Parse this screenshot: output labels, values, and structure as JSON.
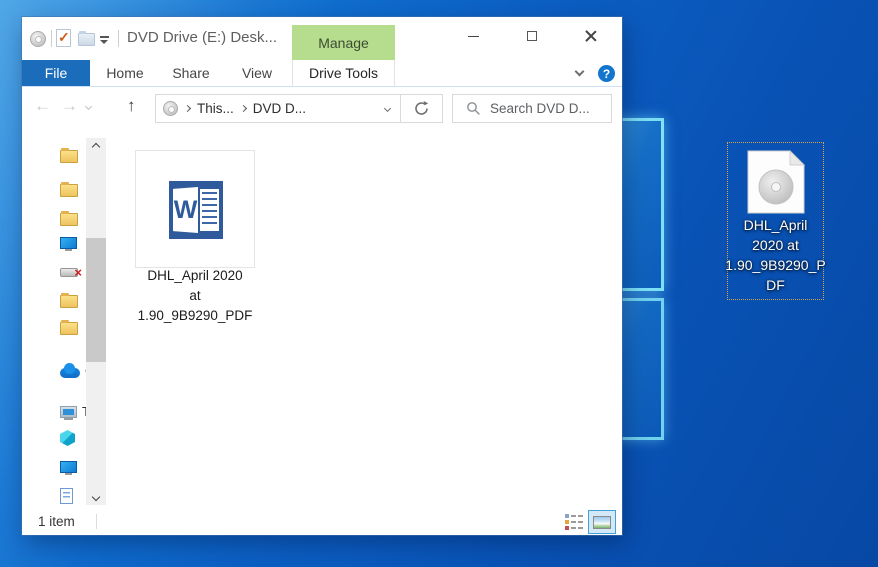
{
  "colors": {
    "accent_blue": "#1b6dbb",
    "manage_green": "#b5dd8d",
    "desktop_blue": "#0c60c4",
    "selection_dotted_border": "#d8a245",
    "word_blue": "#2f5b9d"
  },
  "glyphs": {
    "back_arrow": "←",
    "forward_arrow": "→",
    "up_arrow": "↑",
    "check": "✓",
    "drive_disconnect_x": "×",
    "help": "?"
  },
  "window": {
    "title": "DVD Drive (E:) Desk...",
    "qat_icons": [
      "disc-icon",
      "properties-check-icon",
      "new-folder-icon",
      "customize-caret-icon"
    ],
    "contextual": {
      "header": "Manage",
      "tab": "Drive Tools"
    },
    "tabs": {
      "file": "File",
      "home": "Home",
      "share": "Share",
      "view": "View"
    },
    "controls": [
      "minimize",
      "maximize",
      "close"
    ]
  },
  "navbar": {
    "breadcrumb": {
      "segments": [
        "This...",
        "DVD D..."
      ]
    },
    "search_placeholder": "Search DVD D..."
  },
  "sidebar": {
    "items": [
      {
        "icon": "folder-icon",
        "label": ""
      },
      {
        "icon": "folder-icon",
        "label": ""
      },
      {
        "icon": "folder-icon",
        "label": ""
      },
      {
        "icon": "desktop-monitor-icon",
        "label": ""
      },
      {
        "icon": "disconnected-drive-icon",
        "label": ""
      },
      {
        "icon": "folder-icon",
        "label": ""
      },
      {
        "icon": "folder-icon",
        "label": ""
      },
      {
        "icon": "onedrive-cloud-icon",
        "label": "C"
      },
      {
        "icon": "this-pc-icon",
        "label": "T"
      },
      {
        "icon": "3d-objects-cube-icon",
        "label": ""
      },
      {
        "icon": "desktop-monitor-icon",
        "label": ""
      },
      {
        "icon": "documents-icon",
        "label": ""
      }
    ]
  },
  "content": {
    "file": {
      "icon": "word-document-icon",
      "icon_letter": "W",
      "name_lines": [
        "DHL_April 2020",
        "at",
        "1.90_9B9290_PDF"
      ]
    }
  },
  "statusbar": {
    "count": "1 item",
    "view_buttons": [
      "details-view",
      "large-thumbnails-view"
    ],
    "active_view": "large-thumbnails-view"
  },
  "desktop_icon": {
    "icon": "disc-image-file-icon",
    "label_lines": [
      "DHL_April",
      "2020 at",
      "1.90_9B9290_P",
      "DF"
    ]
  }
}
